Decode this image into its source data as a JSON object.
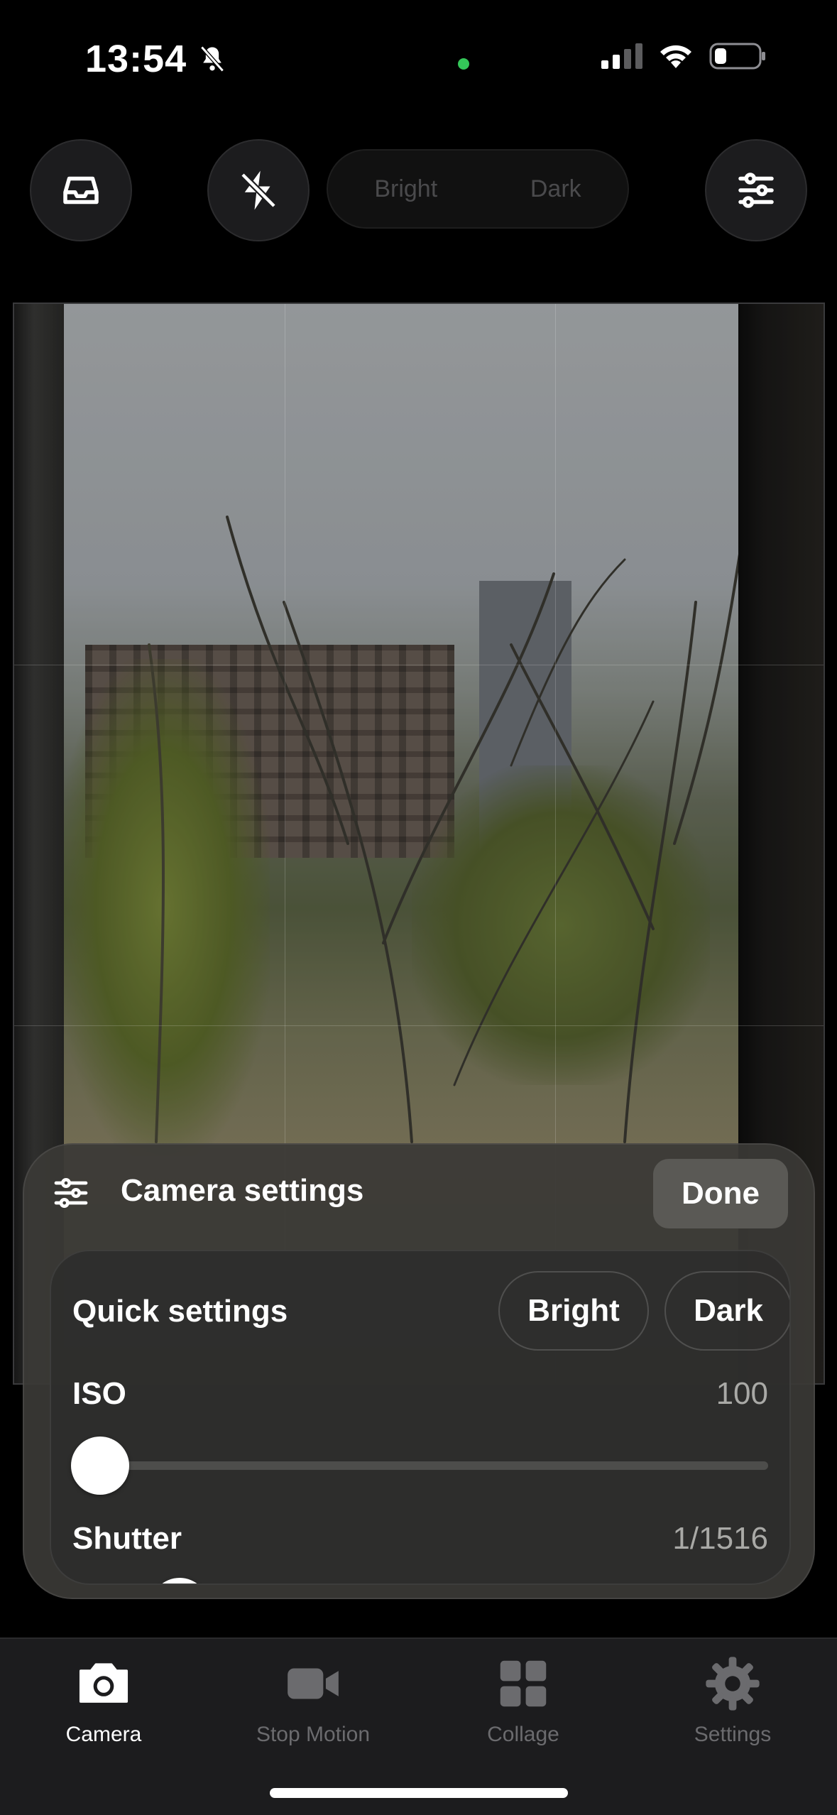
{
  "status_bar": {
    "time": "13:54"
  },
  "top_controls": {
    "preset_bright": "Bright",
    "preset_dark": "Dark"
  },
  "camera_settings": {
    "title": "Camera settings",
    "done_label": "Done",
    "quick_settings": {
      "label": "Quick settings",
      "bright_label": "Bright",
      "dark_label": "Dark"
    },
    "iso": {
      "label": "ISO",
      "value": "100",
      "slider_fraction": 0.0
    },
    "shutter": {
      "label": "Shutter",
      "value": "1/1516"
    }
  },
  "tabs": [
    {
      "label": "Camera",
      "icon": "camera-icon",
      "active": true
    },
    {
      "label": "Stop Motion",
      "icon": "video-icon",
      "active": false
    },
    {
      "label": "Collage",
      "icon": "grid-icon",
      "active": false
    },
    {
      "label": "Settings",
      "icon": "gear-icon",
      "active": false
    }
  ],
  "colors": {
    "active_tab": "#ffffff",
    "inactive_tab": "#6b6b6e",
    "camera_indicator": "#34c759"
  }
}
